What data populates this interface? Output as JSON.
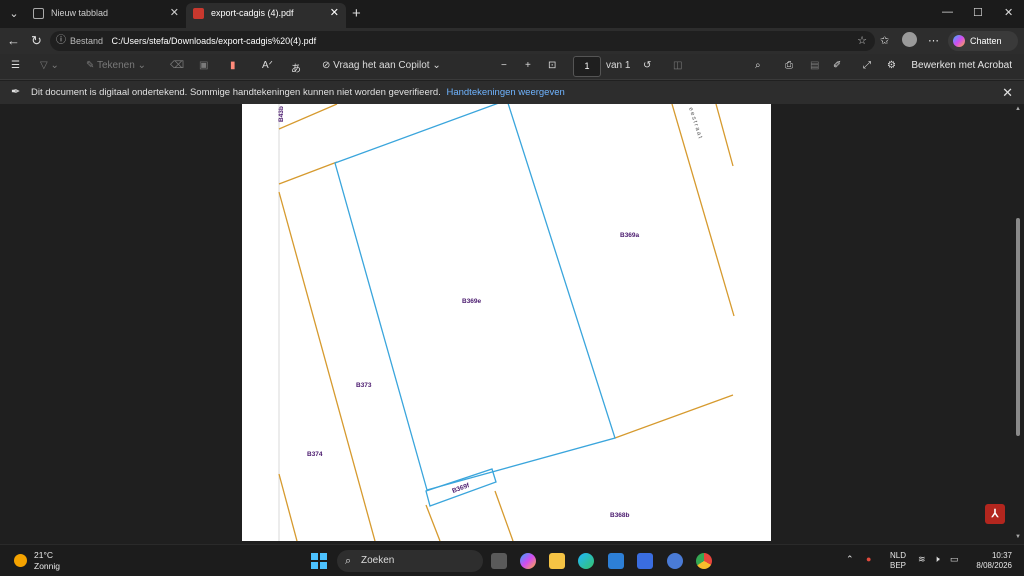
{
  "browser": {
    "tabs": [
      {
        "title": "Nieuw tabblad",
        "active": false
      },
      {
        "title": "export-cadgis (4).pdf",
        "active": true
      }
    ],
    "address": {
      "label": "Bestand",
      "url": "C:/Users/stefa/Downloads/export-cadgis%20(4).pdf"
    },
    "copilot_label": "Chatten"
  },
  "pdf_toolbar": {
    "draw_label": "Tekenen",
    "ask_copilot_label": "Vraag het aan Copilot",
    "page_number": "1",
    "page_total": "van 1",
    "edit_label": "Bewerken met Acrobat"
  },
  "signature_bar": {
    "message": "Dit document is digitaal ondertekend. Sommige handtekeningen kunnen niet worden geverifieerd.",
    "link": "Handtekeningen weergeven"
  },
  "map": {
    "parcel_labels": [
      "B369a",
      "B369e",
      "B373",
      "B374",
      "B369f",
      "B368b",
      "B43b"
    ],
    "street_fragment": "eestraat",
    "colors": {
      "parcel_highlight": "#3aa5dc",
      "parcel_border": "#d69a2e",
      "label": "#4a1a6e"
    }
  },
  "taskbar": {
    "weather_temp": "21°C",
    "weather_desc": "Zonnig",
    "search_placeholder": "Zoeken",
    "lang_top": "NLD",
    "lang_bottom": "BEP",
    "time": "10:37",
    "date": "8/08/2026"
  }
}
